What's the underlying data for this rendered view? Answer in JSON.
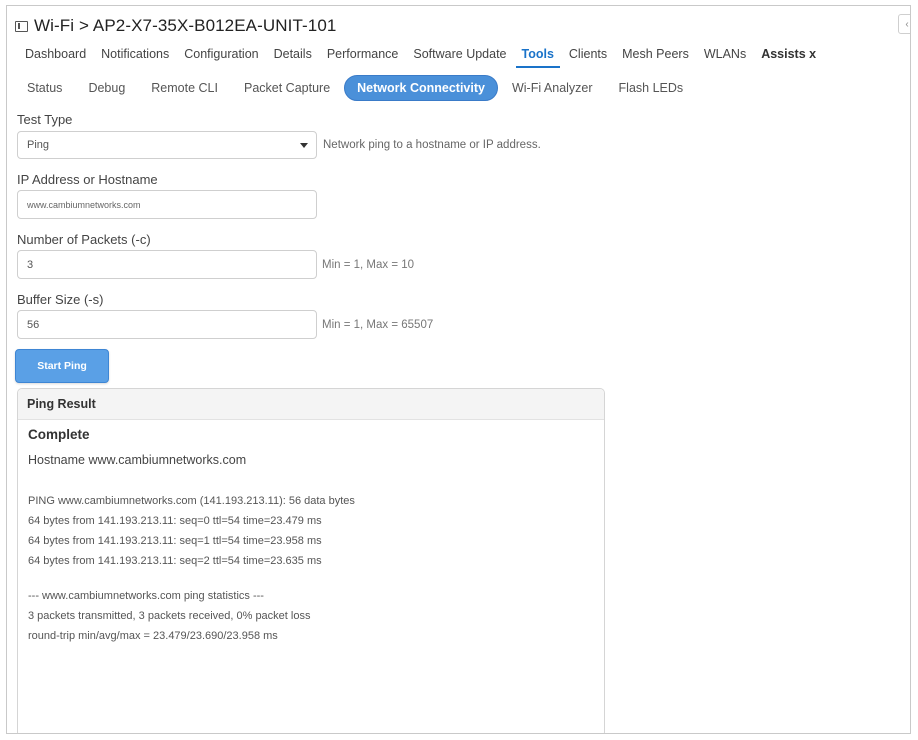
{
  "window": {
    "title": "Wi-Fi > AP2-X7-35X-B012EA-UNIT-101",
    "corner_button": "‹"
  },
  "main_tabs": [
    {
      "label": "Dashboard"
    },
    {
      "label": "Notifications"
    },
    {
      "label": "Configuration"
    },
    {
      "label": "Details"
    },
    {
      "label": "Performance"
    },
    {
      "label": "Software Update"
    },
    {
      "label": "Tools"
    },
    {
      "label": "Clients"
    },
    {
      "label": "Mesh Peers"
    },
    {
      "label": "WLANs"
    },
    {
      "label": "Assists x"
    }
  ],
  "sub_tabs": [
    {
      "label": "Status"
    },
    {
      "label": "Debug"
    },
    {
      "label": "Remote CLI"
    },
    {
      "label": "Packet Capture"
    },
    {
      "label": "Network Connectivity"
    },
    {
      "label": "Wi-Fi Analyzer"
    },
    {
      "label": "Flash LEDs"
    }
  ],
  "form": {
    "test_type_label": "Test Type",
    "test_type_value": "Ping",
    "test_type_hint": "Network ping to a hostname or IP address.",
    "ip_label": "IP Address or Hostname",
    "ip_value": "www.cambiumnetworks.com",
    "packets_label": "Number of Packets (-c)",
    "packets_value": "3",
    "packets_hint": "Min = 1, Max = 10",
    "buffer_label": "Buffer Size (-s)",
    "buffer_value": "56",
    "buffer_hint": "Min = 1, Max = 65507",
    "start_button": "Start Ping"
  },
  "result": {
    "title": "Ping Result",
    "status": "Complete",
    "hostname": "Hostname www.cambiumnetworks.com",
    "lines": [
      "PING www.cambiumnetworks.com (141.193.213.11): 56 data bytes",
      "64 bytes from 141.193.213.11: seq=0 ttl=54 time=23.479 ms",
      "64 bytes from 141.193.213.11: seq=1 ttl=54 time=23.958 ms",
      "64 bytes from 141.193.213.11: seq=2 ttl=54 time=23.635 ms",
      "",
      "--- www.cambiumnetworks.com ping statistics ---",
      "3 packets transmitted, 3 packets received, 0% packet loss",
      "round-trip min/avg/max = 23.479/23.690/23.958 ms"
    ]
  },
  "colors": {
    "accent": "#1a73c9",
    "active_pill": "#4a90d9",
    "button": "#5aa0e6"
  }
}
